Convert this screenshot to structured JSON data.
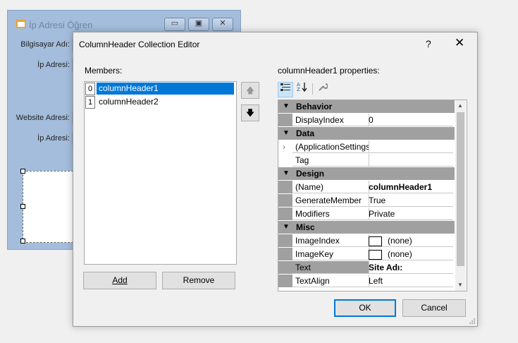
{
  "bgform": {
    "title": "İp Adresi Öğren",
    "minimize": "▭",
    "maximize": "▣",
    "close": "✕",
    "labels": {
      "computer_name": "Bilgisayar Adı:",
      "ip1": "İp Adresi:",
      "website": "Website Adresi:",
      "ip2": "İp Adresi:"
    }
  },
  "dialog": {
    "title": "ColumnHeader Collection Editor",
    "help": "?",
    "close": "✕",
    "members_label": "Members:",
    "members": [
      {
        "index": "0",
        "name": "columnHeader1",
        "selected": true
      },
      {
        "index": "1",
        "name": "columnHeader2",
        "selected": false
      }
    ],
    "move_up": "🡅",
    "move_down": "🡇",
    "add_label": "Add",
    "remove_label": "Remove",
    "properties_label": "columnHeader1 properties:",
    "ok_label": "OK",
    "cancel_label": "Cancel"
  },
  "property_grid": {
    "categories": {
      "behavior": "Behavior",
      "data": "Data",
      "design": "Design",
      "misc": "Misc"
    },
    "rows": {
      "display_index": {
        "name": "DisplayIndex",
        "value": "0"
      },
      "app_settings": {
        "name": "(ApplicationSettings)",
        "value": ""
      },
      "tag": {
        "name": "Tag",
        "value": ""
      },
      "name": {
        "name": "(Name)",
        "value": "columnHeader1"
      },
      "generate_member": {
        "name": "GenerateMember",
        "value": "True"
      },
      "modifiers": {
        "name": "Modifiers",
        "value": "Private"
      },
      "image_index": {
        "name": "ImageIndex",
        "value": "(none)"
      },
      "image_key": {
        "name": "ImageKey",
        "value": "(none)"
      },
      "text": {
        "name": "Text",
        "value": "Site Adı:"
      },
      "text_align": {
        "name": "TextAlign",
        "value": "Left"
      }
    }
  }
}
